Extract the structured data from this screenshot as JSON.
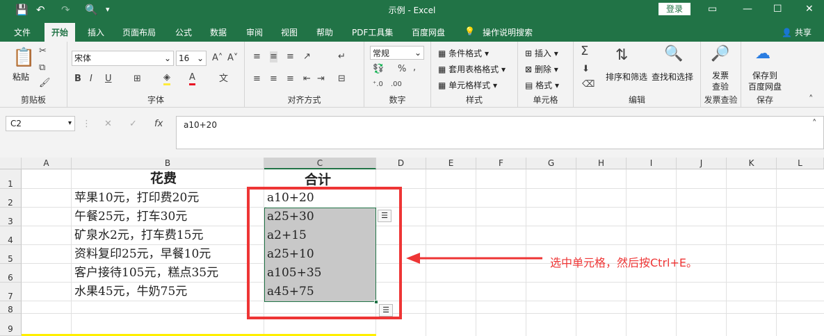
{
  "title": "示例 - Excel",
  "login": "登录",
  "tabs": [
    "文件",
    "开始",
    "插入",
    "页面布局",
    "公式",
    "数据",
    "审阅",
    "视图",
    "帮助",
    "PDF工具集",
    "百度网盘",
    "操作说明搜索"
  ],
  "share": "共享",
  "ribbon": {
    "clipboard": {
      "paste": "粘贴",
      "label": "剪贴板"
    },
    "font": {
      "name": "宋体",
      "size": "16",
      "bold": "B",
      "italic": "I",
      "underline": "U",
      "font_color_glyph": "A",
      "label": "字体"
    },
    "align": {
      "label": "对齐方式"
    },
    "number": {
      "format": "常规",
      "percent": "%",
      "comma": ",",
      "label": "数字"
    },
    "styles": {
      "cond": "条件格式",
      "table": "套用表格格式",
      "cell": "单元格样式",
      "label": "样式"
    },
    "cells": {
      "insert": "插入",
      "delete": "删除",
      "format": "格式",
      "label": "单元格"
    },
    "edit": {
      "sort": "排序和筛选",
      "find": "查找和选择",
      "label": "编辑"
    },
    "invoice": {
      "btn1": "发票",
      "btn2": "查验",
      "label": "发票查验"
    },
    "save": {
      "btn1": "保存到",
      "btn2": "百度网盘",
      "label": "保存"
    }
  },
  "formula_bar": {
    "cell_ref": "C2",
    "fx": "fx",
    "formula": "a10+20"
  },
  "columns": [
    "A",
    "B",
    "C",
    "D",
    "E",
    "F",
    "G",
    "H",
    "I",
    "J",
    "K",
    "L"
  ],
  "rows": [
    "1",
    "2",
    "3",
    "4",
    "5",
    "6",
    "7",
    "8",
    "9"
  ],
  "cells": {
    "B1": "花费",
    "C1": "合计",
    "B": [
      "苹果10元，打印费20元",
      "午餐25元，打车30元",
      "矿泉水2元，打车费15元",
      "资料复印25元，早餐10元",
      "客户接待105元，糕点35元",
      "水果45元，牛奶75元"
    ],
    "C": [
      "a10+20",
      "a25+30",
      "a2+15",
      "a25+10",
      "a105+35",
      "a45+75"
    ]
  },
  "annotation": "选中单元格，然后按Ctrl+E。",
  "colors": {
    "excel_green": "#217346",
    "red": "#ee3535",
    "selection": "#c8c8c8"
  }
}
